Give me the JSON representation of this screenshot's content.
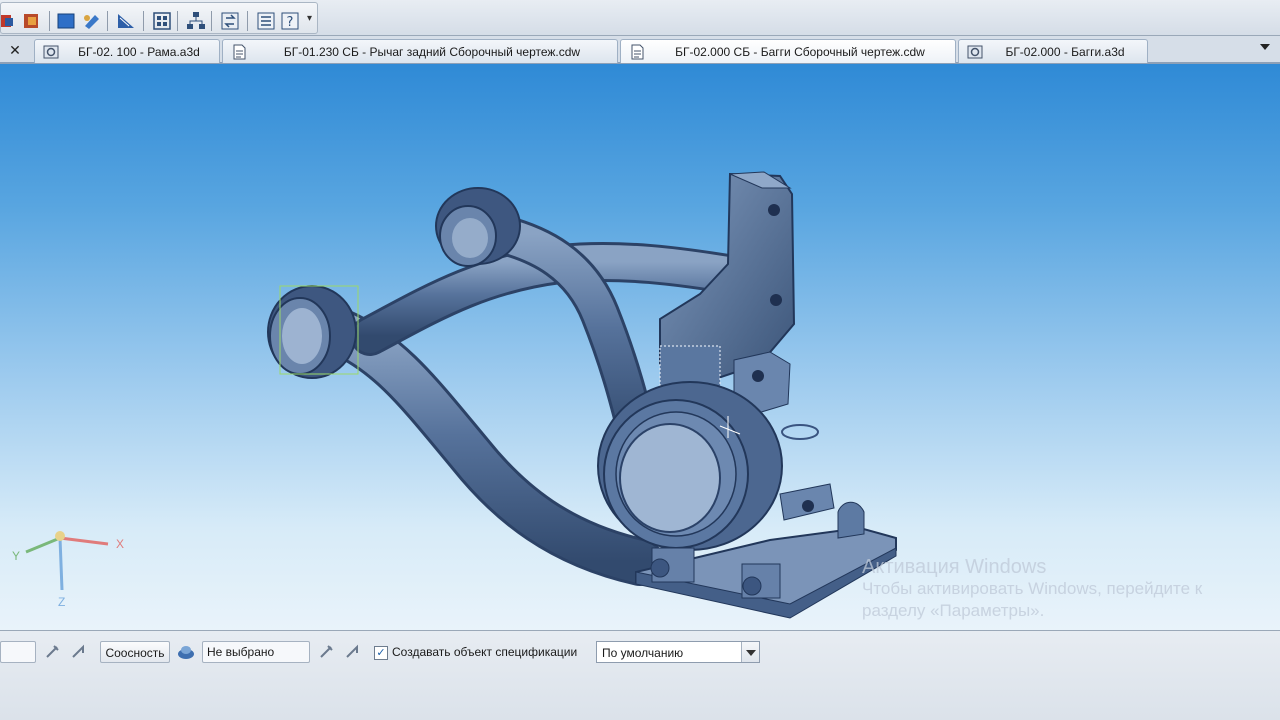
{
  "toolbar": {
    "icons": [
      "bolt-icon",
      "library-icon",
      "view-icon",
      "edit-icon",
      "measure-icon",
      "grid-icon",
      "tree-icon",
      "refresh-icon",
      "list-icon",
      "help-icon"
    ]
  },
  "tabs": [
    {
      "label": "БГ-02. 100 - Рама.a3d",
      "icon": "assembly-doc-icon"
    },
    {
      "label": "БГ-01.230 СБ - Рычаг задний Сборочный чертеж.cdw",
      "icon": "drawing-doc-icon"
    },
    {
      "label": "БГ-02.000 СБ - Багги Сборочный чертеж.cdw",
      "icon": "drawing-doc-icon"
    },
    {
      "label": "БГ-02.000 - Багги.a3d",
      "icon": "assembly-doc-icon"
    }
  ],
  "axes": {
    "x": "X",
    "y": "Y",
    "z": "Z"
  },
  "watermark": {
    "title": "Активация Windows",
    "line1": "Чтобы активировать Windows, перейдите к",
    "line2": "разделу «Параметры»."
  },
  "propbar": {
    "constraint_button": "Соосность",
    "selection_value": "Не выбрано",
    "create_spec_checked": true,
    "create_spec_label": "Создавать объект спецификации",
    "style_select": "По умолчанию"
  },
  "colors": {
    "model_fill": "#4f6c95",
    "viewport_top": "#2f8ad6",
    "viewport_bottom": "#e9f3fa"
  }
}
